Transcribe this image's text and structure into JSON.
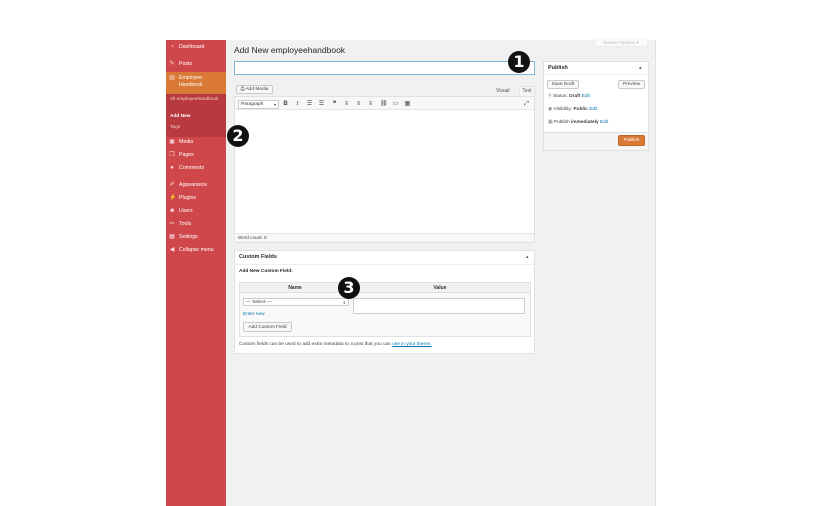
{
  "screen_options": "Screen Options",
  "sidebar": {
    "items": [
      {
        "label": "Dashboard",
        "icon": "dashboard-icon"
      },
      {
        "label": "Posts",
        "icon": "pin-icon"
      },
      {
        "label": "Employee Handbook",
        "icon": "book-icon"
      },
      {
        "label": "Media",
        "icon": "media-icon"
      },
      {
        "label": "Pages",
        "icon": "pages-icon"
      },
      {
        "label": "Comments",
        "icon": "comment-icon"
      },
      {
        "label": "Appearance",
        "icon": "brush-icon"
      },
      {
        "label": "Plugins",
        "icon": "plugin-icon"
      },
      {
        "label": "Users",
        "icon": "users-icon"
      },
      {
        "label": "Tools",
        "icon": "wrench-icon"
      },
      {
        "label": "Settings",
        "icon": "settings-icon"
      },
      {
        "label": "Collapse menu",
        "icon": "collapse-icon"
      }
    ],
    "submenu": [
      "All employeehandbook",
      "Add New",
      "Tags"
    ]
  },
  "page_title": "Add New employeehandbook",
  "title_input": {
    "value": "",
    "placeholder": ""
  },
  "editor": {
    "add_media": "Add Media",
    "tab_visual": "Visual",
    "tab_text": "Text",
    "format_select": "Paragraph",
    "word_count": "Word count: 0"
  },
  "publish": {
    "heading": "Publish",
    "save_draft": "Save Draft",
    "preview": "Preview",
    "status_label": "Status:",
    "status_value": "Draft",
    "visibility_label": "Visibility:",
    "visibility_value": "Public",
    "publish_label": "Publish",
    "publish_value": "immediately",
    "edit": "Edit",
    "publish_button": "Publish"
  },
  "custom_fields": {
    "heading": "Custom Fields",
    "add_new_label": "Add New Custom Field:",
    "col_name": "Name",
    "col_value": "Value",
    "select_value": "— Select —",
    "enter_new": "Enter new",
    "add_button": "Add Custom Field",
    "help_text": "Custom fields can be used to add extra metadata to a post that you can",
    "help_link": "use in your theme."
  },
  "markers": [
    "1",
    "2",
    "3"
  ]
}
